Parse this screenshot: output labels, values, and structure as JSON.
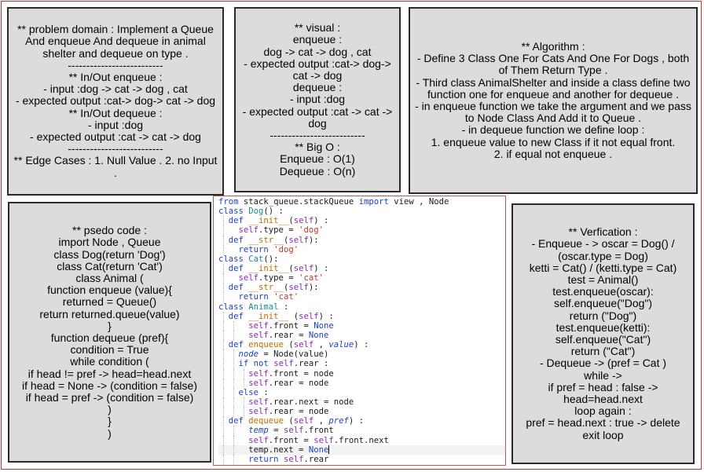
{
  "problem_domain": {
    "lines": [
      "** problem domain : Implement a Queue And enqueue And dequeue in animal shelter and dequeue on type .",
      "--------------------------",
      "** In/Out enqueue :",
      "- input :dog -> cat -> dog , cat",
      "- expected output :cat-> dog-> cat -> dog",
      "** In/Out dequeue :",
      "- input :dog",
      "- expected output :cat -> cat -> dog",
      "--------------------------",
      "** Edge Cases : 1. Null Value . 2. no Input ."
    ]
  },
  "visual": {
    "lines": [
      "** visual :",
      "enqueue :",
      "dog -> cat -> dog , cat",
      "- expected output :cat-> dog-> cat -> dog",
      "dequeue :",
      "- input :dog",
      "- expected output :cat -> cat -> dog",
      "--------------------------",
      "** Big O :",
      "Enqueue : O(1)",
      "Dequeue : O(n)"
    ]
  },
  "algorithm": {
    "lines": [
      "** Algorithm :",
      "- Define 3 Class One For Cats And One For Dogs , both of Them Return Type .",
      "- Third class AnimalShelter and inside a class define two function one for enqueue and another for dequeue .",
      "- in enqueue function we take the argument and we pass to Node Class And Add it to Queue .",
      "- in dequeue function we define loop :",
      "1. enqueue value to new Class if it not equal front.",
      "2. if equal not enqueue ."
    ]
  },
  "psedo_code": {
    "lines": [
      "** psedo code :",
      "import Node , Queue",
      "class Dog(return 'Dog')",
      "class Cat(return 'Cat')",
      "class Animal (",
      "function enqueue (value){",
      "returned = Queue()",
      "return returned.queue(value)",
      "}",
      "function dequeue (pref){",
      "condition = True",
      "while condition (",
      "if head != pref -> head=head.next",
      "if head = None -> (condition = false)",
      "if head = pref -> (condition = false)",
      ")",
      "}",
      ")"
    ]
  },
  "verification": {
    "lines": [
      "** Verfication :",
      "- Enqueue - > oscar = Dog() / (oscar.type = Dog)",
      "ketti = Cat() / (ketti.type = Cat)",
      "test = Animal()",
      "test.enqueue(oscar):",
      "self.enqueue(\"Dog\")",
      "return (\"Dog\")",
      "test.enqueue(ketti):",
      "self.enqueue(\"Cat\")",
      "return (\"Cat\")",
      "- Dequeue -> (pref = Cat )",
      "while ->",
      "if pref = head : false -> head=head.next",
      "loop again :",
      "pref = head.next : true -> delete",
      "exit loop"
    ]
  },
  "code": {
    "lines": [
      [
        [
          "kw",
          "from"
        ],
        [
          "plain",
          " stack_queue.stackQueue "
        ],
        [
          "kw",
          "import"
        ],
        [
          "plain",
          " view , Node"
        ]
      ],
      [
        [
          "kw",
          "class"
        ],
        [
          "plain",
          " "
        ],
        [
          "cls",
          "Dog"
        ],
        [
          "plain",
          "() :"
        ]
      ],
      [
        [
          "plain",
          "  "
        ],
        [
          "kw",
          "def"
        ],
        [
          "plain",
          " "
        ],
        [
          "fn",
          "__init__"
        ],
        [
          "plain",
          "("
        ],
        [
          "self",
          "self"
        ],
        [
          "plain",
          ") :"
        ]
      ],
      [
        [
          "plain",
          "    "
        ],
        [
          "self",
          "self"
        ],
        [
          "plain",
          ".type = "
        ],
        [
          "str",
          "'dog'"
        ]
      ],
      [
        [
          "plain",
          "  "
        ],
        [
          "kw",
          "def"
        ],
        [
          "plain",
          " "
        ],
        [
          "fn",
          "__str__"
        ],
        [
          "plain",
          "("
        ],
        [
          "self",
          "self"
        ],
        [
          "plain",
          "):"
        ]
      ],
      [
        [
          "plain",
          "    "
        ],
        [
          "kw",
          "return"
        ],
        [
          "plain",
          " "
        ],
        [
          "str",
          "'dog'"
        ]
      ],
      [
        [
          "kw",
          "class"
        ],
        [
          "plain",
          " "
        ],
        [
          "cls",
          "Cat"
        ],
        [
          "plain",
          "():"
        ]
      ],
      [
        [
          "plain",
          "  "
        ],
        [
          "kw",
          "def"
        ],
        [
          "plain",
          " "
        ],
        [
          "fn",
          "__init__"
        ],
        [
          "plain",
          "("
        ],
        [
          "self",
          "self"
        ],
        [
          "plain",
          ") :"
        ]
      ],
      [
        [
          "plain",
          "    "
        ],
        [
          "self",
          "self"
        ],
        [
          "plain",
          ".type = "
        ],
        [
          "str",
          "'cat'"
        ]
      ],
      [
        [
          "plain",
          "  "
        ],
        [
          "kw",
          "def"
        ],
        [
          "plain",
          " "
        ],
        [
          "fn",
          "__str__"
        ],
        [
          "plain",
          "("
        ],
        [
          "self",
          "self"
        ],
        [
          "plain",
          "):"
        ]
      ],
      [
        [
          "plain",
          "    "
        ],
        [
          "kw",
          "return"
        ],
        [
          "plain",
          " "
        ],
        [
          "str",
          "'cat'"
        ]
      ],
      [
        [
          "kw",
          "class"
        ],
        [
          "plain",
          " "
        ],
        [
          "cls",
          "Animal"
        ],
        [
          "plain",
          " :"
        ]
      ],
      [
        [
          "plain",
          "  "
        ],
        [
          "kw",
          "def"
        ],
        [
          "plain",
          " "
        ],
        [
          "fn",
          "__init__"
        ],
        [
          "plain",
          " ("
        ],
        [
          "self",
          "self"
        ],
        [
          "plain",
          ") :"
        ]
      ],
      [
        [
          "plain",
          "      "
        ],
        [
          "self",
          "self"
        ],
        [
          "plain",
          ".front = "
        ],
        [
          "kw",
          "None"
        ]
      ],
      [
        [
          "plain",
          "      "
        ],
        [
          "self",
          "self"
        ],
        [
          "plain",
          ".rear = "
        ],
        [
          "kw",
          "None"
        ]
      ],
      [
        [
          "plain",
          "  "
        ],
        [
          "kw",
          "def"
        ],
        [
          "plain",
          " "
        ],
        [
          "fn",
          "enqueue"
        ],
        [
          "plain",
          " ("
        ],
        [
          "self",
          "self"
        ],
        [
          "plain",
          " , "
        ],
        [
          "var",
          "value"
        ],
        [
          "plain",
          ") :"
        ]
      ],
      [
        [
          "plain",
          "    "
        ],
        [
          "var",
          "node"
        ],
        [
          "plain",
          " = Node(value)"
        ]
      ],
      [
        [
          "plain",
          "    "
        ],
        [
          "kw",
          "if not"
        ],
        [
          "plain",
          " "
        ],
        [
          "self",
          "self"
        ],
        [
          "plain",
          ".rear :"
        ]
      ],
      [
        [
          "plain",
          "      "
        ],
        [
          "self",
          "self"
        ],
        [
          "plain",
          ".front = node"
        ]
      ],
      [
        [
          "plain",
          "      "
        ],
        [
          "self",
          "self"
        ],
        [
          "plain",
          ".rear = node"
        ]
      ],
      [
        [
          "plain",
          "    "
        ],
        [
          "kw",
          "else"
        ],
        [
          "plain",
          " :"
        ]
      ],
      [
        [
          "plain",
          "      "
        ],
        [
          "self",
          "self"
        ],
        [
          "plain",
          ".rear.next = node"
        ]
      ],
      [
        [
          "plain",
          "      "
        ],
        [
          "self",
          "self"
        ],
        [
          "plain",
          ".rear = node"
        ]
      ],
      [
        [
          "plain",
          "  "
        ],
        [
          "kw",
          "def"
        ],
        [
          "plain",
          " "
        ],
        [
          "fn",
          "dequeue"
        ],
        [
          "plain",
          " ("
        ],
        [
          "self",
          "self"
        ],
        [
          "plain",
          " , "
        ],
        [
          "var",
          "pref"
        ],
        [
          "plain",
          ") :"
        ]
      ],
      [
        [
          "plain",
          "      "
        ],
        [
          "var",
          "temp"
        ],
        [
          "plain",
          " = "
        ],
        [
          "self",
          "self"
        ],
        [
          "plain",
          ".front"
        ]
      ],
      [
        [
          "plain",
          "      "
        ],
        [
          "self",
          "self"
        ],
        [
          "plain",
          ".front = "
        ],
        [
          "self",
          "self"
        ],
        [
          "plain",
          ".front.next"
        ]
      ],
      [
        [
          "plain",
          "      temp.next = "
        ],
        [
          "kw",
          "None"
        ]
      ],
      [
        [
          "plain",
          "      "
        ],
        [
          "kw",
          "return"
        ],
        [
          "plain",
          " "
        ],
        [
          "self",
          "self"
        ],
        [
          "plain",
          ".rear"
        ]
      ]
    ]
  }
}
